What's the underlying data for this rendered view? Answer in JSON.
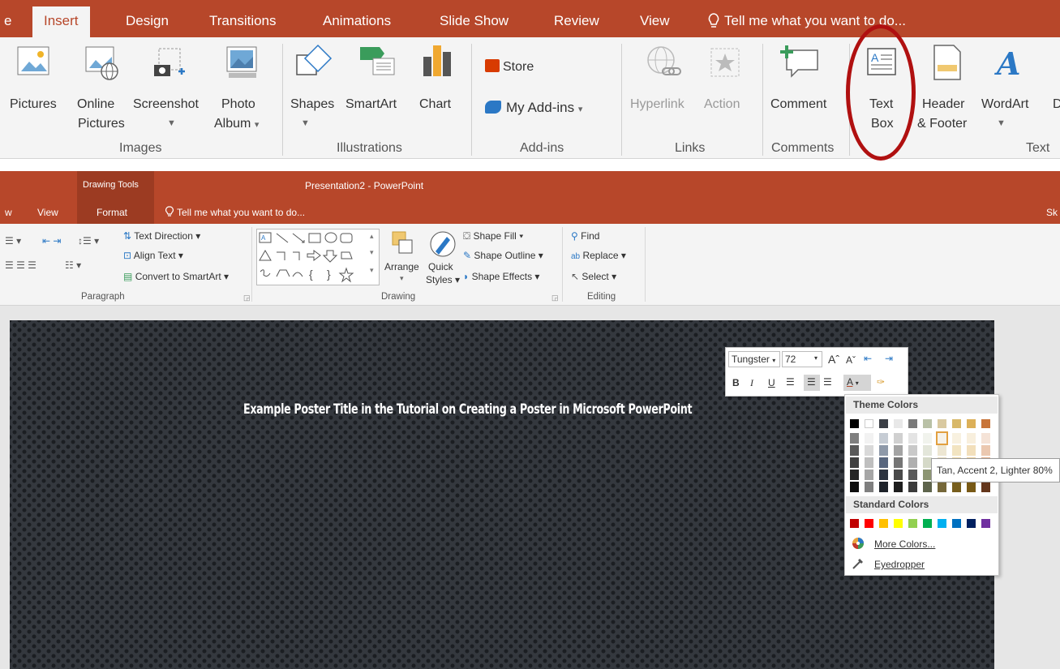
{
  "top_ribbon": {
    "tabs": [
      {
        "label": "e"
      },
      {
        "label": "Insert"
      },
      {
        "label": "Design"
      },
      {
        "label": "Transitions"
      },
      {
        "label": "Animations"
      },
      {
        "label": "Slide Show"
      },
      {
        "label": "Review"
      },
      {
        "label": "View"
      }
    ],
    "tell_me": "Tell me what you want to do...",
    "buttons": {
      "pictures": "Pictures",
      "online_pictures_1": "Online",
      "online_pictures_2": "Pictures",
      "screenshot": "Screenshot",
      "photo_album_1": "Photo",
      "photo_album_2": "Album",
      "shapes": "Shapes",
      "smartart": "SmartArt",
      "chart": "Chart",
      "store": "Store",
      "my_addins": "My Add-ins",
      "hyperlink": "Hyperlink",
      "action": "Action",
      "comment": "Comment",
      "text_box_1": "Text",
      "text_box_2": "Box",
      "header_footer_1": "Header",
      "header_footer_2": "& Footer",
      "wordart": "WordArt",
      "partial": "D"
    },
    "groups": {
      "images": "Images",
      "illustrations": "Illustrations",
      "addins": "Add-ins",
      "links": "Links",
      "comments": "Comments",
      "text": "Text"
    }
  },
  "bottom_window": {
    "context_header": "Drawing Tools",
    "title": "Presentation2 - PowerPoint",
    "tabs": {
      "partial_w": "w",
      "view": "View",
      "format": "Format",
      "tell_me": "Tell me what you want to do...",
      "partial_sk": "Sk"
    },
    "paragraph": {
      "text_direction": "Text Direction",
      "align_text": "Align Text",
      "convert_smartart": "Convert to SmartArt",
      "label": "Paragraph"
    },
    "drawing": {
      "arrange": "Arrange",
      "quick_styles_1": "Quick",
      "quick_styles_2": "Styles",
      "shape_fill": "Shape Fill",
      "shape_outline": "Shape Outline",
      "shape_effects": "Shape Effects",
      "label": "Drawing"
    },
    "editing": {
      "find": "Find",
      "replace": "Replace",
      "select": "Select",
      "label": "Editing"
    }
  },
  "slide": {
    "title": "Example Poster Title in the Tutorial on Creating a Poster in Microsoft PowerPoint"
  },
  "mini_toolbar": {
    "font": "Tungster",
    "size": "72",
    "bold": "B",
    "italic": "I",
    "underline": "U",
    "font_color": "A"
  },
  "color_menu": {
    "theme_header": "Theme Colors",
    "standard_header": "Standard Colors",
    "more_colors": "More Colors...",
    "eyedropper": "Eyedropper",
    "tooltip": "Tan, Accent 2, Lighter 80%",
    "theme_top_row": [
      "#000000",
      "#ffffff",
      "#3b3f46",
      "#e8e8e8",
      "#7a7a7a",
      "#b9c1a6",
      "#d9c9a0",
      "#d8b868",
      "#dcb058",
      "#c8753a"
    ],
    "theme_columns": [
      [
        "#7f7f7f",
        "#595959",
        "#3f3f3f",
        "#262626",
        "#0d0d0d"
      ],
      [
        "#f2f2f2",
        "#d9d9d9",
        "#bfbfbf",
        "#a6a6a6",
        "#7f7f7f"
      ],
      [
        "#c6ccd4",
        "#8e99a9",
        "#58667e",
        "#2c333f",
        "#1d2229"
      ],
      [
        "#d0d0d0",
        "#a3a3a3",
        "#757575",
        "#4a4a4a",
        "#1e1e1e"
      ],
      [
        "#e4e4e4",
        "#c9c9c9",
        "#afafaf",
        "#5b5b5b",
        "#3c3c3c"
      ],
      [
        "#f1f3ed",
        "#e3e6da",
        "#d5d9c8",
        "#8d9673",
        "#5e644c"
      ],
      [
        "#f6f2e9",
        "#ede6d2",
        "#e5d9bc",
        "#b09b5c",
        "#756739"
      ],
      [
        "#f8f1e0",
        "#f2e4c1",
        "#ebd6a3",
        "#b28e2c",
        "#775e1d"
      ],
      [
        "#f8efdd",
        "#f2dfbb",
        "#eccf99",
        "#b58520",
        "#785915"
      ],
      [
        "#f5e3d7",
        "#ebc8b0",
        "#e1ac88",
        "#96532a",
        "#64371c"
      ]
    ],
    "standard_colors": [
      "#c00000",
      "#ff0000",
      "#ffc000",
      "#ffff00",
      "#92d050",
      "#00b050",
      "#00b0f0",
      "#0070c0",
      "#002060",
      "#7030a0"
    ]
  }
}
